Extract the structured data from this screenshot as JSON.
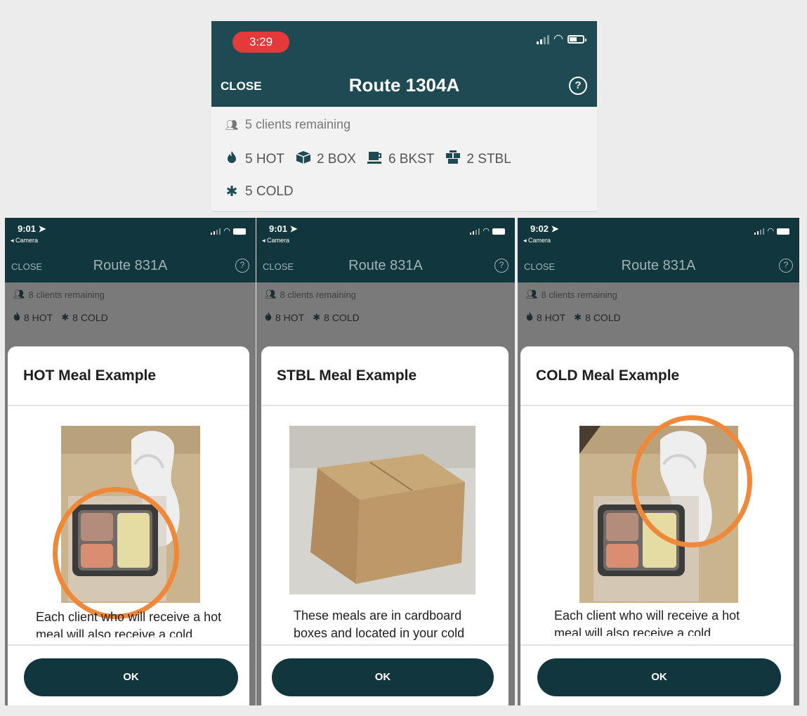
{
  "top_phone": {
    "status_time": "3:29",
    "close_label": "CLOSE",
    "title": "Route 1304A",
    "help_icon": "question-circle-icon",
    "clients_remaining": "5 clients remaining",
    "meal_tags": [
      {
        "icon": "flame-icon",
        "label": "5 HOT"
      },
      {
        "icon": "box-icon",
        "label": "2 BOX"
      },
      {
        "icon": "coffee-icon",
        "label": "6 BKST"
      },
      {
        "icon": "shelf-box-icon",
        "label": "2 STBL"
      },
      {
        "icon": "snowflake-icon",
        "label": "5 COLD"
      }
    ]
  },
  "screens": [
    {
      "status_time": "9:01",
      "back_label": "◂ Camera",
      "close_label": "CLOSE",
      "title": "Route 831A",
      "clients_remaining": "8 clients remaining",
      "tags": [
        "8 HOT",
        "8 COLD"
      ],
      "modal_title": "HOT Meal Example",
      "modal_text_1": "Each client who will receive a hot",
      "modal_text_2": "meal will also receive a cold",
      "ok_label": "OK"
    },
    {
      "status_time": "9:01",
      "back_label": "◂ Camera",
      "close_label": "CLOSE",
      "title": "Route 831A",
      "clients_remaining": "8 clients remaining",
      "tags": [
        "8 HOT",
        "8 COLD"
      ],
      "modal_title": "STBL Meal Example",
      "modal_text_1": "These meals are in cardboard",
      "modal_text_2": "boxes and located in your cold",
      "ok_label": "OK"
    },
    {
      "status_time": "9:02",
      "back_label": "◂ Camera",
      "close_label": "CLOSE",
      "title": "Route 831A",
      "clients_remaining": "8 clients remaining",
      "tags": [
        "8 HOT",
        "8 COLD"
      ],
      "modal_title": "COLD Meal Example",
      "modal_text_1": "Each client who will receive a hot",
      "modal_text_2": "meal will also receive a cold",
      "ok_label": "OK"
    }
  ],
  "colors": {
    "header_teal": "#1d4a53",
    "button_teal": "#12363d",
    "time_badge_red": "#e63a3a",
    "highlight_orange": "#f0883a"
  }
}
